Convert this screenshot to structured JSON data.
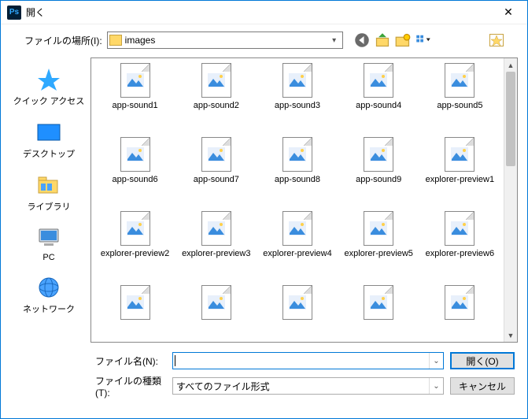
{
  "title": "開く",
  "location_label": "ファイルの場所(I):",
  "location_value": "images",
  "sidebar": [
    {
      "label": "クイック アクセス",
      "icon": "quick"
    },
    {
      "label": "デスクトップ",
      "icon": "desktop"
    },
    {
      "label": "ライブラリ",
      "icon": "library"
    },
    {
      "label": "PC",
      "icon": "pc"
    },
    {
      "label": "ネットワーク",
      "icon": "network"
    }
  ],
  "files": [
    "app-sound1",
    "app-sound2",
    "app-sound3",
    "app-sound4",
    "app-sound5",
    "app-sound6",
    "app-sound7",
    "app-sound8",
    "app-sound9",
    "explorer-preview1",
    "explorer-preview2",
    "explorer-preview3",
    "explorer-preview4",
    "explorer-preview5",
    "explorer-preview6",
    "",
    "",
    "",
    "",
    ""
  ],
  "filename_label": "ファイル名(N):",
  "filename_value": "",
  "filetype_label": "ファイルの種類(T):",
  "filetype_value": "すべてのファイル形式",
  "open_btn": "開く(O)",
  "cancel_btn": "キャンセル"
}
